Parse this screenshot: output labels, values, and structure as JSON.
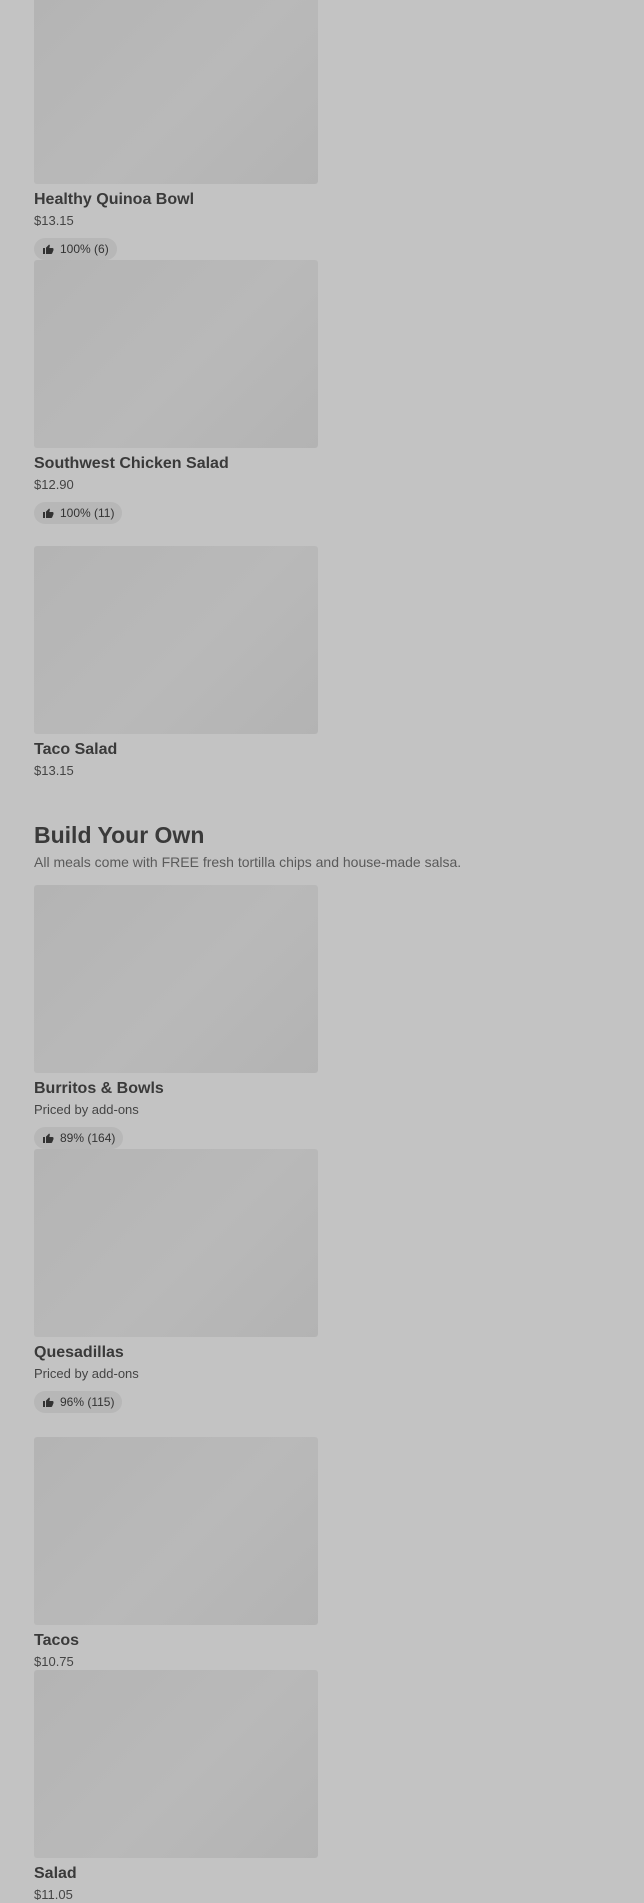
{
  "sections": {
    "salads_row": [
      {
        "title": "Healthy Quinoa Bowl",
        "price": "$13.15",
        "rating": "100% (6)"
      },
      {
        "title": "Southwest Chicken Salad",
        "price": "$12.90",
        "rating": "100% (11)"
      },
      {
        "title": "Taco Salad",
        "price": "$13.15"
      }
    ],
    "build_your_own": {
      "title": "Build Your Own",
      "subtitle": "All meals come with FREE fresh tortilla chips and house-made salsa.",
      "items": [
        {
          "title": "Burritos & Bowls",
          "price": "Priced by add-ons",
          "rating": "89% (164)"
        },
        {
          "title": "Quesadillas",
          "price": "Priced by add-ons",
          "rating": "96% (115)"
        },
        {
          "title": "Tacos",
          "price": "$10.75"
        },
        {
          "title": "Salad",
          "price": "$11.05"
        }
      ]
    }
  },
  "icons": {
    "rating": "thumbs-up-icon"
  }
}
